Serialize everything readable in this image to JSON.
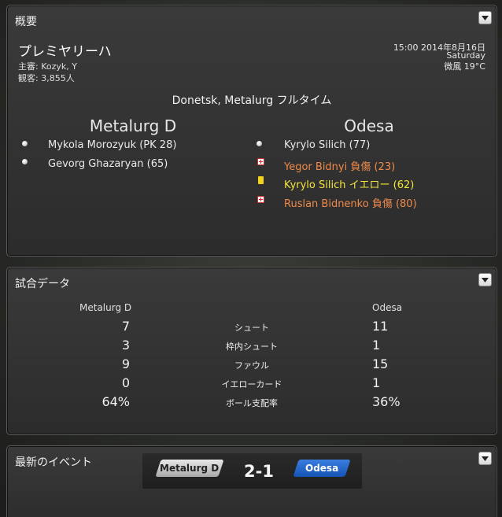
{
  "overview": {
    "title": "概要",
    "league": "プレミヤリーハ",
    "referee": "主審: Kozyk, Y",
    "attendance": "観客: 3,855人",
    "datetime": "15:00 2014年8月16日",
    "weekday": "Saturday",
    "weather": "微風 19°C",
    "venue_status": "Donetsk, Metalurg フルタイム",
    "home_team": "Metalurg D",
    "away_team": "Odesa",
    "home_events": [
      {
        "icon": "goal-ball-icon",
        "text": "Mykola Morozyuk (PK 28)"
      },
      {
        "icon": "goal-ball-icon",
        "text": "Gevorg Ghazaryan (65)"
      }
    ],
    "away_events": [
      {
        "icon": "goal-ball-icon",
        "text": "Kyrylo Silich (77)"
      },
      {
        "icon": "injury-icon",
        "text": "Yegor Bidnyi 負傷 (23)"
      },
      {
        "icon": "yellow-card-icon",
        "text": "Kyrylo Silich イエロー (62)"
      },
      {
        "icon": "injury-icon",
        "text": "Ruslan Bidnenko 負傷 (80)"
      }
    ]
  },
  "stats": {
    "title": "試合データ",
    "home_team": "Metalurg D",
    "away_team": "Odesa",
    "rows": [
      {
        "label": "シュート",
        "home": "7",
        "away": "11"
      },
      {
        "label": "枠内シュート",
        "home": "3",
        "away": "1"
      },
      {
        "label": "ファウル",
        "home": "9",
        "away": "15"
      },
      {
        "label": "イエローカード",
        "home": "0",
        "away": "1"
      },
      {
        "label": "ボール支配率",
        "home": "64%",
        "away": "36%"
      }
    ]
  },
  "latest": {
    "title": "最新のイベント",
    "home_team": "Metalurg D",
    "away_team": "Odesa",
    "score": "2-1"
  },
  "colors": {
    "injury_text": "#f08a4b",
    "yellow_text": "#f3e43a",
    "away_tag": "#2a6ad0"
  }
}
